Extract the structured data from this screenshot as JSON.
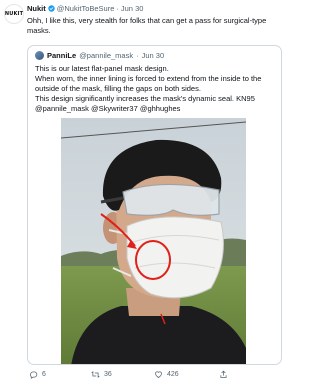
{
  "tweet": {
    "avatar_text": "NUKIT",
    "author_name": "Nukit",
    "author_handle": "@NukitToBeSure",
    "separator": "·",
    "date": "Jun 30",
    "text": "Ohh, I like this, very stealth for folks that can get a pass for surgical-type masks."
  },
  "quote": {
    "author_name": "PanniLe",
    "author_handle": "@pannile_mask",
    "separator": "·",
    "date": "Jun 30",
    "lines": [
      "This is our latest flat-panel mask design.",
      "When worn, the inner lining is forced to extend from the inside to the",
      "outside of the mask, filling the gaps on both sides.",
      "This design significantly increases the mask's dynamic seal. KN95",
      "@pannile_mask @Skywriter37 @ghhughes"
    ]
  },
  "actions": {
    "replies": "6",
    "retweets": "36",
    "likes": "426",
    "share_label": ""
  },
  "icons": {
    "verified": "verified-badge-icon",
    "reply": "reply-icon",
    "retweet": "retweet-icon",
    "like": "heart-icon",
    "share": "share-icon"
  },
  "colors": {
    "verified": "#1d9bf0",
    "secondary_text": "#536471",
    "annotation": "#e0201b"
  }
}
